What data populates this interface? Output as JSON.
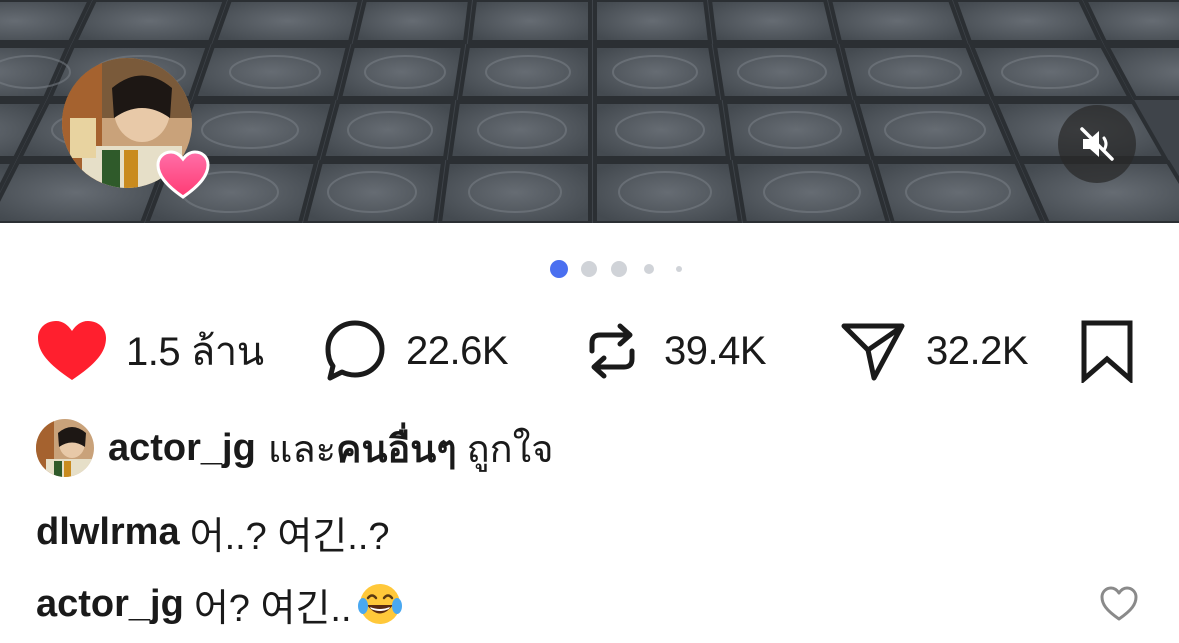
{
  "carousel": {
    "total_slides": 5,
    "active_index": 0,
    "active_color": "#4a6ff0",
    "inactive_color": "#d0d3d8"
  },
  "media": {
    "mute_icon": "speaker-muted-icon",
    "avatar_badge_icon": "pink-heart-icon"
  },
  "actions": {
    "like": {
      "icon": "heart-filled-icon",
      "count": "1.5 ล้าน",
      "color": "#ff1f2e"
    },
    "comment": {
      "icon": "speech-bubble-icon",
      "count": "22.6K"
    },
    "repost": {
      "icon": "repost-icon",
      "count": "39.4K"
    },
    "share": {
      "icon": "send-icon",
      "count": "32.2K"
    },
    "save": {
      "icon": "bookmark-icon"
    }
  },
  "liked_by": {
    "username": "actor_jg",
    "connector": "และ",
    "others": "คนอื่นๆ",
    "suffix": "ถูกใจ"
  },
  "comments": [
    {
      "user": "dlwlrma",
      "text": "어..? 여긴..?"
    },
    {
      "user": "actor_jg",
      "text": "어? 여긴..",
      "emoji": "face-with-tears-of-joy"
    }
  ]
}
